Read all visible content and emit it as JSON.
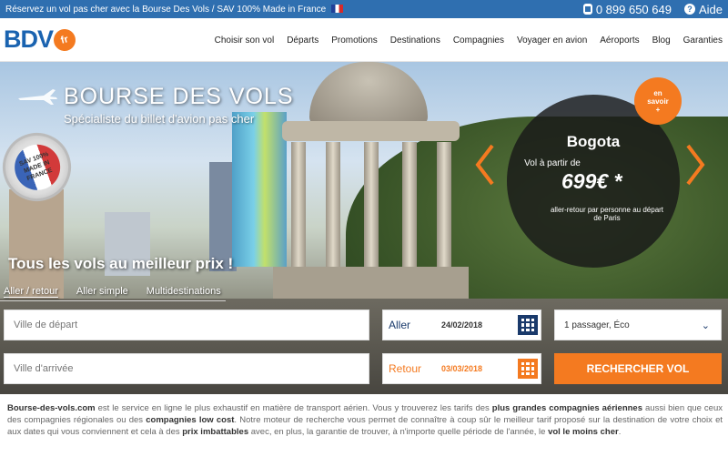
{
  "topbar": {
    "promo": "Réservez un vol pas cher avec la Bourse Des Vols / SAV 100% Made in France",
    "phone": "0 899 650 649",
    "help": "Aide"
  },
  "logo": {
    "brand": "BDV",
    "suffix": "fr"
  },
  "nav": [
    "Choisir son vol",
    "Départs",
    "Promotions",
    "Destinations",
    "Compagnies",
    "Voyager en avion",
    "Aéroports",
    "Blog",
    "Garanties"
  ],
  "hero": {
    "title": "BOURSE DES VOLS",
    "subtitle": "Spécialiste du billet d'avion pas cher",
    "badge": {
      "line1": "SAV 100%",
      "line2": "MADE IN FRANCE"
    },
    "slogan": "Tous les vols au meilleur prix !"
  },
  "promo": {
    "city": "Bogota",
    "from": "Vol à partir de",
    "price": "699€ *",
    "note": "aller-retour par personne au départ de Paris",
    "more": {
      "line1": "en",
      "line2": "savoir",
      "line3": "+"
    }
  },
  "search": {
    "tabs": [
      "Aller / retour",
      "Aller simple",
      "Multidestinations"
    ],
    "departure_placeholder": "Ville de départ",
    "arrival_placeholder": "Ville d'arrivée",
    "outbound_label": "Aller",
    "outbound_date": "24/02/2018",
    "return_label": "Retour",
    "return_date": "03/03/2018",
    "passengers": "1 passager, Éco",
    "button": "RECHERCHER VOL"
  },
  "footer": {
    "site": "Bourse-des-vols.com",
    "t1": " est le service en ligne le plus exhaustif en matière de transport aérien. Vous y trouverez les tarifs des ",
    "b1": "plus grandes compagnies aériennes",
    "t2": " aussi bien que ceux des compagnies régionales ou des ",
    "b2": "compagnies low cost",
    "t3": ". Notre moteur de recherche vous permet de connaître à coup sûr le meilleur tarif proposé sur la destination de votre choix et aux dates qui vous conviennent et cela à des ",
    "b3": "prix imbattables",
    "t4": " avec, en plus, la garantie de trouver, à n'importe quelle période de l'année, le ",
    "b4": "vol le moins cher",
    "t5": "."
  },
  "colors": {
    "primary": "#2f6fb0",
    "accent": "#f47a20",
    "navy": "#1a3a6b"
  }
}
